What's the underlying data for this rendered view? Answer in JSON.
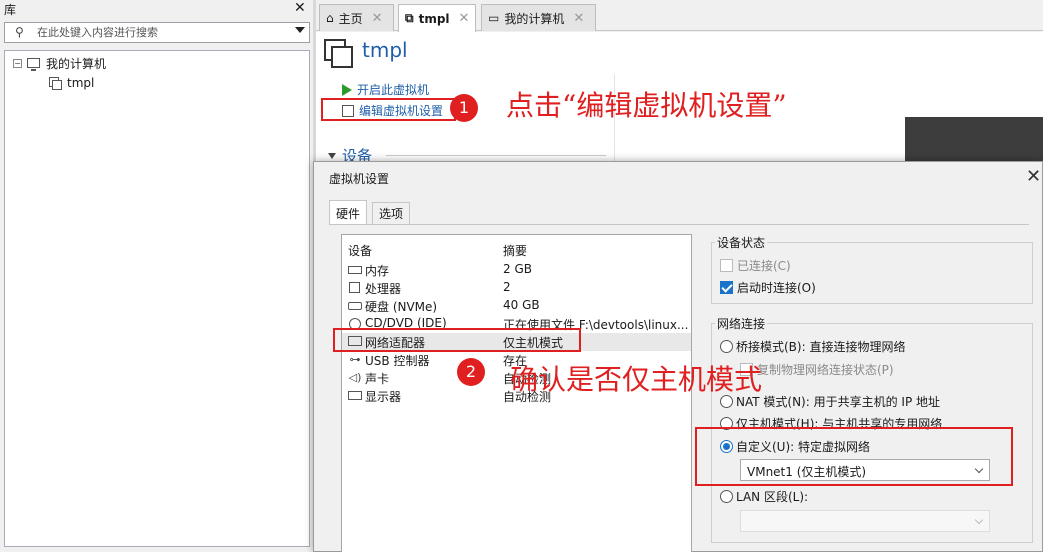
{
  "library": {
    "title": "库",
    "search_placeholder": "在此处键入内容进行搜索",
    "tree": [
      {
        "label": "我的计算机"
      },
      {
        "label": "tmpl"
      }
    ]
  },
  "tabs": [
    {
      "label": "主页"
    },
    {
      "label": "tmpl"
    },
    {
      "label": "我的计算机"
    }
  ],
  "vm": {
    "title": "tmpl",
    "commands": {
      "start": "开启此虚拟机",
      "edit": "编辑虚拟机设置"
    },
    "devices_header": "设备"
  },
  "annotations": {
    "step1_num": "1",
    "step1_text": "点击“编辑虚拟机设置”",
    "step2_num": "2",
    "step2_text": "确认是否仅主机模式"
  },
  "dialog": {
    "title": "虚拟机设置",
    "tabs": [
      "硬件",
      "选项"
    ],
    "columns": {
      "device": "设备",
      "summary": "摘要"
    },
    "hardware": [
      {
        "name": "内存",
        "summary": "2 GB",
        "icon": "memory-icon"
      },
      {
        "name": "处理器",
        "summary": "2",
        "icon": "cpu-icon"
      },
      {
        "name": "硬盘 (NVMe)",
        "summary": "40 GB",
        "icon": "disk-icon"
      },
      {
        "name": "CD/DVD (IDE)",
        "summary": "正在使用文件 F:\\devtools\\linux...",
        "icon": "cd-icon"
      },
      {
        "name": "网络适配器",
        "summary": "仅主机模式",
        "icon": "network-icon"
      },
      {
        "name": "USB 控制器",
        "summary": "存在",
        "icon": "usb-icon"
      },
      {
        "name": "声卡",
        "summary": "自动检测",
        "icon": "sound-icon"
      },
      {
        "name": "显示器",
        "summary": "自动检测",
        "icon": "display-icon"
      }
    ],
    "device_status": {
      "title": "设备状态",
      "connected": "已连接(C)",
      "connect_on_power": "启动时连接(O)"
    },
    "network": {
      "title": "网络连接",
      "bridged": "桥接模式(B): 直接连接物理网络",
      "replicate": "复制物理网络连接状态(P)",
      "nat": "NAT 模式(N): 用于共享主机的 IP 地址",
      "hostonly": "仅主机模式(H): 与主机共享的专用网络",
      "custom": "自定义(U): 特定虚拟网络",
      "custom_value": "VMnet1 (仅主机模式)",
      "lan": "LAN 区段(L):",
      "lan_value": ""
    }
  }
}
